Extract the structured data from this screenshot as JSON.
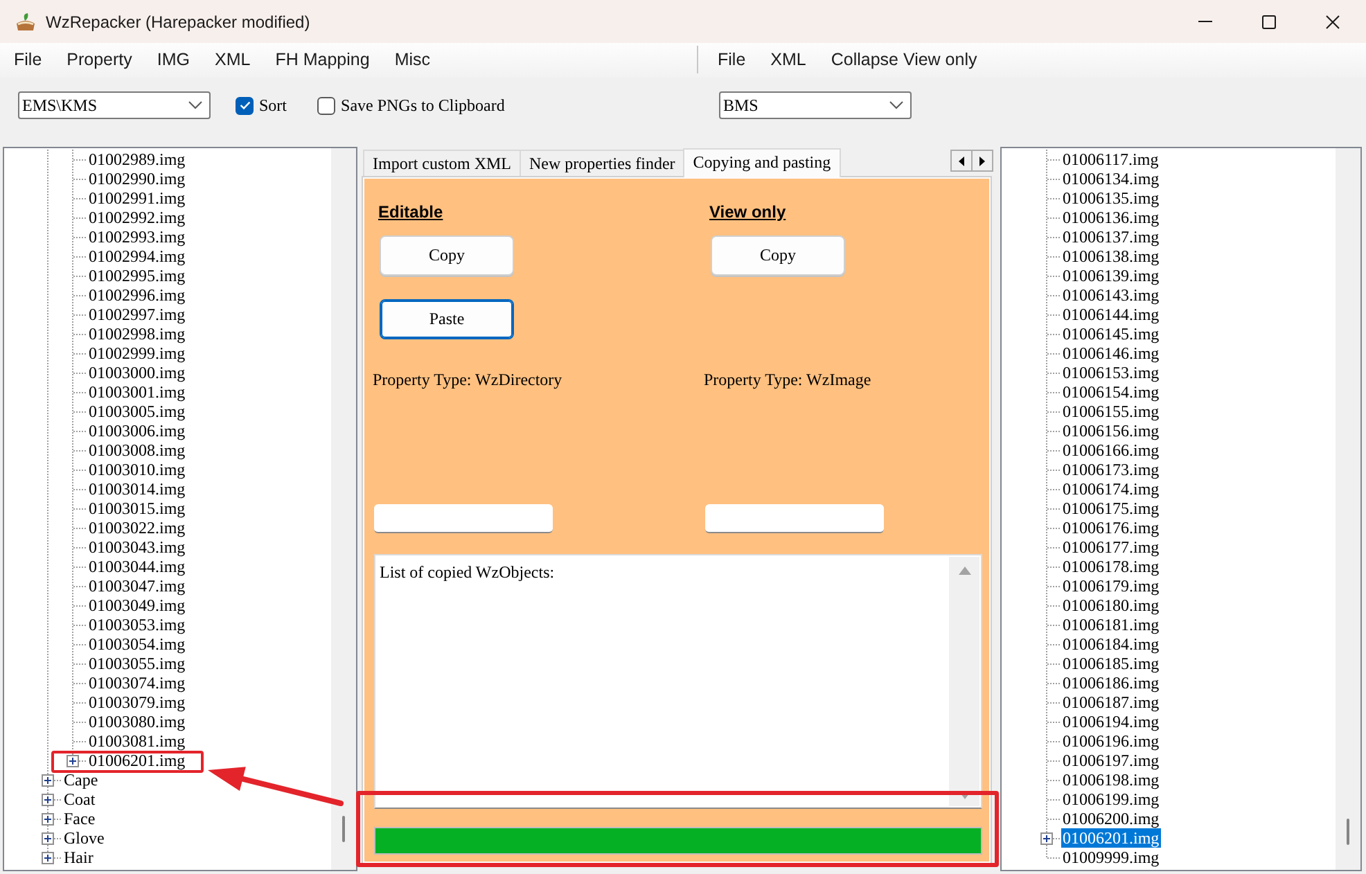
{
  "window": {
    "title": "WzRepacker (Harepacker modified)"
  },
  "left_menu": [
    "File",
    "Property",
    "IMG",
    "XML",
    "FH Mapping",
    "Misc"
  ],
  "left_toolbar": {
    "version_dropdown": {
      "value": "EMS\\KMS"
    },
    "options": [
      {
        "label": "Sort",
        "checked": true
      },
      {
        "label": "Save PNGs to Clipboard",
        "checked": false
      }
    ]
  },
  "right_menu": [
    "File",
    "XML",
    "Collapse View only"
  ],
  "right_toolbar": {
    "version_dropdown": {
      "value": "BMS"
    }
  },
  "left_tree": {
    "items": [
      {
        "children": [
          {
            "label": "01002989.img",
            "kind": "leaf",
            "selected": false
          },
          {
            "label": "01002990.img",
            "kind": "leaf",
            "selected": false
          },
          {
            "label": "01002991.img",
            "kind": "leaf",
            "selected": false
          },
          {
            "label": "01002992.img",
            "kind": "leaf",
            "selected": false
          },
          {
            "label": "01002993.img",
            "kind": "leaf",
            "selected": false
          },
          {
            "label": "01002994.img",
            "kind": "leaf",
            "selected": false
          },
          {
            "label": "01002995.img",
            "kind": "leaf",
            "selected": false
          },
          {
            "label": "01002996.img",
            "kind": "leaf",
            "selected": false
          },
          {
            "label": "01002997.img",
            "kind": "leaf",
            "selected": false
          },
          {
            "label": "01002998.img",
            "kind": "leaf",
            "selected": false
          },
          {
            "label": "01002999.img",
            "kind": "leaf",
            "selected": false
          },
          {
            "label": "01003000.img",
            "kind": "leaf",
            "selected": false
          },
          {
            "label": "01003001.img",
            "kind": "leaf",
            "selected": false
          },
          {
            "label": "01003005.img",
            "kind": "leaf",
            "selected": false
          },
          {
            "label": "01003006.img",
            "kind": "leaf",
            "selected": false
          },
          {
            "label": "01003008.img",
            "kind": "leaf",
            "selected": false
          },
          {
            "label": "01003010.img",
            "kind": "leaf",
            "selected": false
          },
          {
            "label": "01003014.img",
            "kind": "leaf",
            "selected": false
          },
          {
            "label": "01003015.img",
            "kind": "leaf",
            "selected": false
          },
          {
            "label": "01003022.img",
            "kind": "leaf",
            "selected": false
          },
          {
            "label": "01003043.img",
            "kind": "leaf",
            "selected": false
          },
          {
            "label": "01003044.img",
            "kind": "leaf",
            "selected": false
          },
          {
            "label": "01003047.img",
            "kind": "leaf",
            "selected": false
          },
          {
            "label": "01003049.img",
            "kind": "leaf",
            "selected": false
          },
          {
            "label": "01003053.img",
            "kind": "leaf",
            "selected": false
          },
          {
            "label": "01003054.img",
            "kind": "leaf",
            "selected": false
          },
          {
            "label": "01003055.img",
            "kind": "leaf",
            "selected": false
          },
          {
            "label": "01003074.img",
            "kind": "leaf",
            "selected": false
          },
          {
            "label": "01003079.img",
            "kind": "leaf",
            "selected": false
          },
          {
            "label": "01003080.img",
            "kind": "leaf",
            "selected": false
          },
          {
            "label": "01003081.img",
            "kind": "leaf",
            "selected": false
          },
          {
            "label": "01006201.img",
            "kind": "collapsed",
            "selected": false
          }
        ]
      },
      {
        "label": "Cape",
        "kind": "collapsed",
        "selected": false
      },
      {
        "label": "Coat",
        "kind": "collapsed",
        "selected": false
      },
      {
        "label": "Face",
        "kind": "collapsed",
        "selected": false
      },
      {
        "label": "Glove",
        "kind": "collapsed",
        "selected": false
      },
      {
        "label": "Hair",
        "kind": "collapsed",
        "selected": false
      }
    ]
  },
  "tabs": [
    {
      "label": "Import custom XML",
      "selected": false
    },
    {
      "label": "New properties finder",
      "selected": false
    },
    {
      "label": "Copying and pasting",
      "selected": true
    }
  ],
  "copy_panel": {
    "columns": [
      {
        "heading": "Editable",
        "buttons": [
          {
            "label": "Copy",
            "focused": false
          },
          {
            "label": "Paste",
            "focused": true
          }
        ],
        "property_type": "Property Type: WzDirectory"
      },
      {
        "heading": "View only",
        "buttons": [
          {
            "label": "Copy",
            "focused": false
          }
        ],
        "property_type": "Property Type: WzImage"
      }
    ],
    "copied_list": {
      "text": "List of copied WzObjects:"
    },
    "progress": {
      "level": 1
    }
  },
  "right_tree": {
    "items": [
      {
        "label": "01006117.img",
        "kind": "leaf",
        "selected": false
      },
      {
        "label": "01006134.img",
        "kind": "leaf",
        "selected": false
      },
      {
        "label": "01006135.img",
        "kind": "leaf",
        "selected": false
      },
      {
        "label": "01006136.img",
        "kind": "leaf",
        "selected": false
      },
      {
        "label": "01006137.img",
        "kind": "leaf",
        "selected": false
      },
      {
        "label": "01006138.img",
        "kind": "leaf",
        "selected": false
      },
      {
        "label": "01006139.img",
        "kind": "leaf",
        "selected": false
      },
      {
        "label": "01006143.img",
        "kind": "leaf",
        "selected": false
      },
      {
        "label": "01006144.img",
        "kind": "leaf",
        "selected": false
      },
      {
        "label": "01006145.img",
        "kind": "leaf",
        "selected": false
      },
      {
        "label": "01006146.img",
        "kind": "leaf",
        "selected": false
      },
      {
        "label": "01006153.img",
        "kind": "leaf",
        "selected": false
      },
      {
        "label": "01006154.img",
        "kind": "leaf",
        "selected": false
      },
      {
        "label": "01006155.img",
        "kind": "leaf",
        "selected": false
      },
      {
        "label": "01006156.img",
        "kind": "leaf",
        "selected": false
      },
      {
        "label": "01006166.img",
        "kind": "leaf",
        "selected": false
      },
      {
        "label": "01006173.img",
        "kind": "leaf",
        "selected": false
      },
      {
        "label": "01006174.img",
        "kind": "leaf",
        "selected": false
      },
      {
        "label": "01006175.img",
        "kind": "leaf",
        "selected": false
      },
      {
        "label": "01006176.img",
        "kind": "leaf",
        "selected": false
      },
      {
        "label": "01006177.img",
        "kind": "leaf",
        "selected": false
      },
      {
        "label": "01006178.img",
        "kind": "leaf",
        "selected": false
      },
      {
        "label": "01006179.img",
        "kind": "leaf",
        "selected": false
      },
      {
        "label": "01006180.img",
        "kind": "leaf",
        "selected": false
      },
      {
        "label": "01006181.img",
        "kind": "leaf",
        "selected": false
      },
      {
        "label": "01006184.img",
        "kind": "leaf",
        "selected": false
      },
      {
        "label": "01006185.img",
        "kind": "leaf",
        "selected": false
      },
      {
        "label": "01006186.img",
        "kind": "leaf",
        "selected": false
      },
      {
        "label": "01006187.img",
        "kind": "leaf",
        "selected": false
      },
      {
        "label": "01006194.img",
        "kind": "leaf",
        "selected": false
      },
      {
        "label": "01006196.img",
        "kind": "leaf",
        "selected": false
      },
      {
        "label": "01006197.img",
        "kind": "leaf",
        "selected": false
      },
      {
        "label": "01006198.img",
        "kind": "leaf",
        "selected": false
      },
      {
        "label": "01006199.img",
        "kind": "leaf",
        "selected": false
      },
      {
        "label": "01006200.img",
        "kind": "leaf",
        "selected": false
      },
      {
        "label": "01006201.img",
        "kind": "collapsed",
        "selected": true
      },
      {
        "label": "01009999.img",
        "kind": "leaf",
        "selected": false
      }
    ]
  }
}
